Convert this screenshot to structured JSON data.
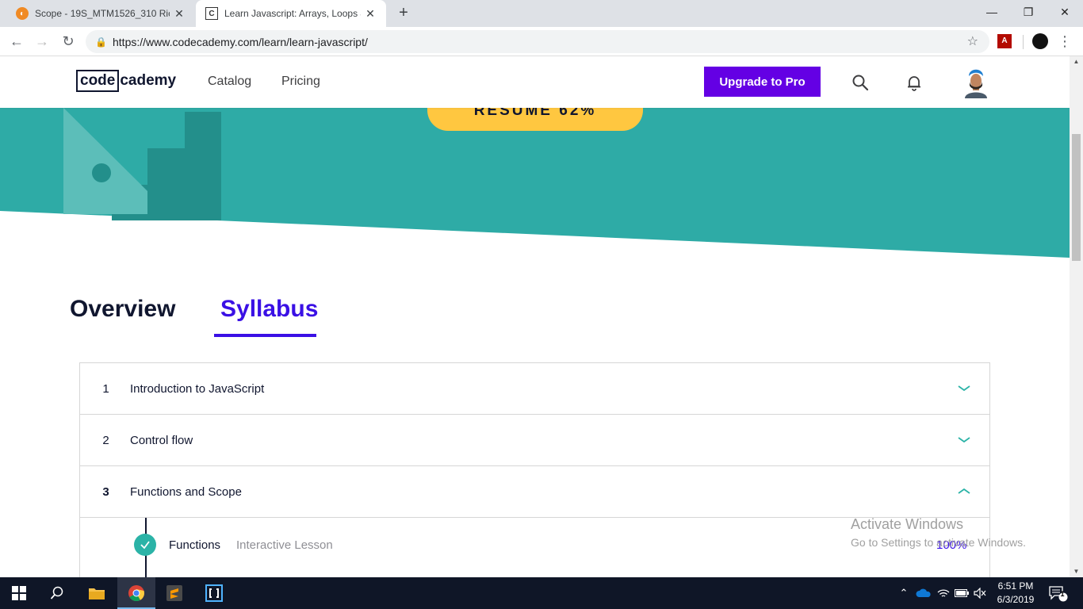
{
  "browser": {
    "tabs": [
      {
        "title": "Scope - 19S_MTM1526_310 Rich",
        "icon": "scope-favicon",
        "active": false
      },
      {
        "title": "Learn Javascript: Arrays, Loops &",
        "icon": "codecademy-favicon",
        "active": true
      }
    ],
    "url": "https://www.codecademy.com/learn/learn-javascript/"
  },
  "site": {
    "logo_box": "code",
    "logo_rest": "cademy",
    "nav": [
      "Catalog",
      "Pricing"
    ],
    "upgrade_label": "Upgrade to Pro"
  },
  "hero": {
    "resume_label": "RESUME 62%",
    "colors": {
      "teal": "#2eaba6",
      "accent": "#ffc740"
    }
  },
  "page_tabs": [
    {
      "label": "Overview",
      "active": false
    },
    {
      "label": "Syllabus",
      "active": true
    }
  ],
  "syllabus": {
    "units": [
      {
        "number": "1",
        "title": "Introduction to JavaScript",
        "expanded": false
      },
      {
        "number": "2",
        "title": "Control flow",
        "expanded": false
      },
      {
        "number": "3",
        "title": "Functions and Scope",
        "expanded": true
      }
    ],
    "lessons": [
      {
        "name": "Functions",
        "type": "Interactive Lesson",
        "progress": "100%",
        "complete": true
      }
    ]
  },
  "watermark": {
    "line1": "Activate Windows",
    "line2": "Go to Settings to activate Windows."
  },
  "taskbar": {
    "time": "6:51 PM",
    "date": "6/3/2019",
    "notification_count": "1"
  }
}
